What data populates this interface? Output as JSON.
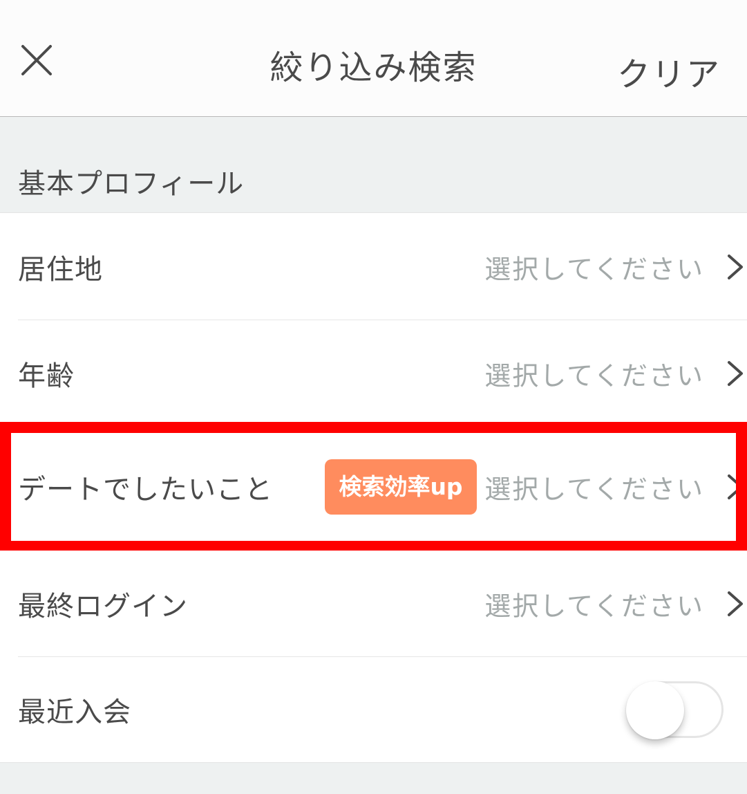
{
  "header": {
    "title": "絞り込み検索",
    "close_icon": "close-icon",
    "clear_label": "クリア"
  },
  "section": {
    "title": "基本プロフィール"
  },
  "rows": [
    {
      "label": "居住地",
      "value": "選択してください",
      "icon": "chevron-right-icon"
    },
    {
      "label": "年齢",
      "value": "選択してください",
      "icon": "chevron-right-icon"
    },
    {
      "label": "デートでしたいこと",
      "value": "選択してください",
      "badge": "検索効率up",
      "icon": "chevron-right-icon"
    },
    {
      "label": "最終ログイン",
      "value": "選択してください",
      "icon": "chevron-right-icon"
    },
    {
      "label": "最近入会",
      "toggle_on": false
    }
  ],
  "colors": {
    "badge": "#ff8c5e",
    "highlight": "#ff0000",
    "placeholder": "#a3a9a9",
    "section_bg": "#eef1f1"
  }
}
